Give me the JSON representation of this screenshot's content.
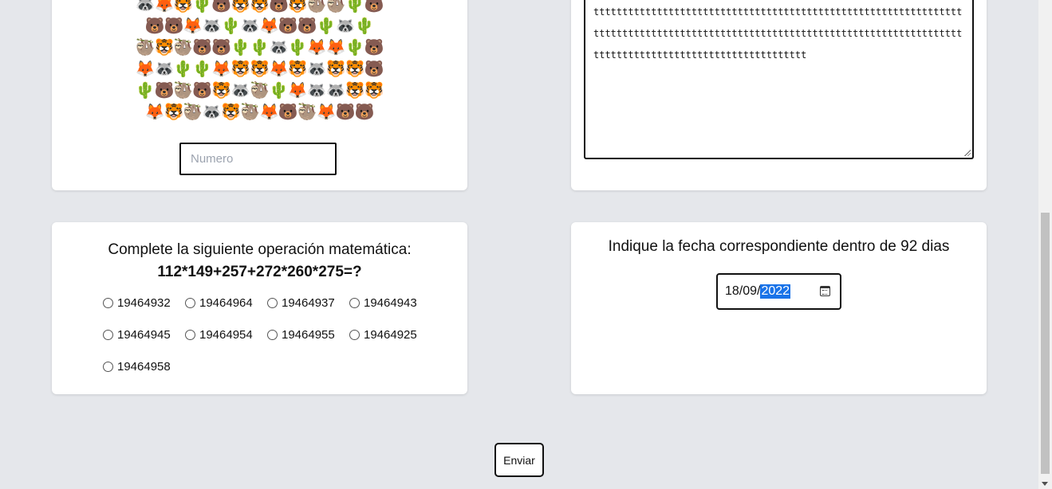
{
  "emoji_captcha": {
    "rows": [
      "🦝🦊🐯🌵🐻🐯🐯🐻🐯🦥🦥🌵🐻",
      "🐻🐻🦊🦝🌵🦝🦊🐻🐻🌵🦝🌵",
      "🦥🐯🦥🐻🐻🌵🌵🦝🌵🦊🦊🌵🐻",
      "🦊🦝🌵🌵🦊🐯🐯🦊🐯🦝🐯🐯🐻",
      "🌵🐻🦥🐻🐯🦝🦥🌵🦊🦝🦝🐯🐯",
      "🦊🐯🦥🦝🐯🦥🦊🐻🦥🦊🐻🐻"
    ],
    "input_placeholder": "Numero"
  },
  "text_area": {
    "value": "ttttttttttttttttttttttttttttttttttttttttttttttttttttttttttttttttttttttttttttttttttttttttttttttttttttttttttttttttttttttttttttttttttttttttttttttttttttttttttttttttttttt"
  },
  "math_question": {
    "title": "Complete la siguiente operación matemática:",
    "expression": "112*149+257+272*260*275=?",
    "options": [
      "19464932",
      "19464964",
      "19464937",
      "19464943",
      "19464945",
      "19464954",
      "19464955",
      "19464925",
      "19464958"
    ]
  },
  "date_question": {
    "title": "Indique la fecha correspondiente dentro de 92 dias",
    "date_day_month": "18/09/",
    "date_year": "2022",
    "calendar_icon": "calendar-icon"
  },
  "submit": {
    "label": "Enviar"
  }
}
